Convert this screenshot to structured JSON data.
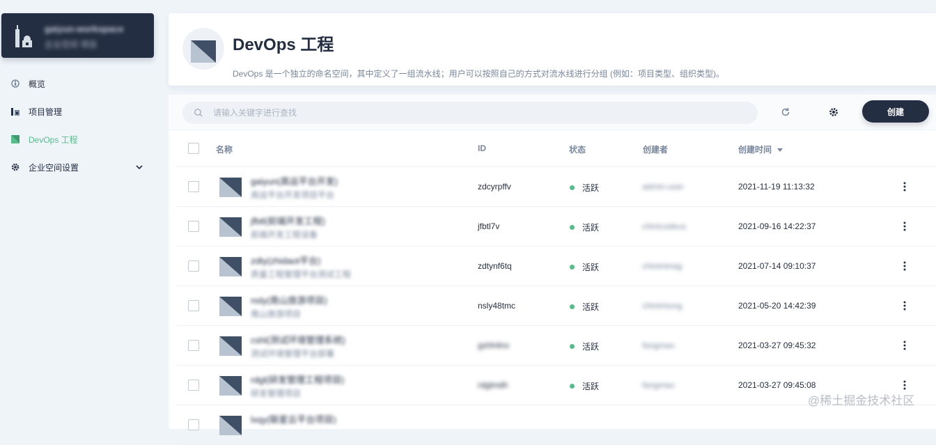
{
  "workspace": {
    "name": "gaiyun-workspace",
    "subtitle": "企业空间 项目"
  },
  "nav": [
    {
      "label": "概览",
      "icon": "dashboard-icon"
    },
    {
      "label": "项目管理",
      "icon": "project-icon"
    },
    {
      "label": "DevOps 工程",
      "icon": "devops-icon",
      "active": true
    },
    {
      "label": "企业空间设置",
      "icon": "gear-icon",
      "expandable": true
    }
  ],
  "header": {
    "title": "DevOps 工程",
    "description": "DevOps 是一个独立的命名空间，其中定义了一组流水线；用户可以按照自己的方式对流水线进行分组 (例如：项目类型、组织类型)。"
  },
  "toolbar": {
    "search_placeholder": "请输入关键字进行查找",
    "create_label": "创建"
  },
  "table": {
    "columns": {
      "name": "名称",
      "id": "ID",
      "status": "状态",
      "creator": "创建者",
      "created_time": "创建时间"
    },
    "rows": [
      {
        "name": "gaiyun(高运平台开发)",
        "desc": "高运平台开发项目平台",
        "id": "zdcyrpffv",
        "id_blurred": false,
        "status": "活跃",
        "creator": "admin-user",
        "time": "2021-11-19 11:13:32"
      },
      {
        "name": "jfbtl(前端开发工程)",
        "desc": "前端开发工程设备",
        "id": "jfbtl7v",
        "id_blurred": false,
        "status": "活跃",
        "creator": "chinicodeus",
        "time": "2021-09-16 14:22:37"
      },
      {
        "name": "zdty(zhidaot平台)",
        "desc": "质量工程管理平台测试工程",
        "id": "zdtynf6tq",
        "id_blurred": false,
        "status": "活跃",
        "creator": "chiniminag",
        "time": "2021-07-14 09:10:37"
      },
      {
        "name": "nsly(南山旅游项目)",
        "desc": "南山旅游项目",
        "id": "nsly48tmc",
        "id_blurred": false,
        "status": "活跃",
        "creator": "chinimiung",
        "time": "2021-05-20 14:42:39"
      },
      {
        "name": "cshl(测试环境管理系统)",
        "desc": "测试环境管理平台部署",
        "id": "gxhh4nv",
        "id_blurred": true,
        "status": "活跃",
        "creator": "fangmao",
        "time": "2021-03-27 09:45:32"
      },
      {
        "name": "rdgl(研发管理工程项目)",
        "desc": "研发管理项目",
        "id": "rdglmdh",
        "id_blurred": true,
        "status": "活跃",
        "creator": "fangmao",
        "time": "2021-03-27 09:45:08"
      },
      {
        "name": "lxqy(联星云平台项目)",
        "desc": "",
        "id": "",
        "id_blurred": false,
        "status": "",
        "creator": "",
        "time": ""
      }
    ]
  },
  "watermark": "@稀土掘金技术社区"
}
